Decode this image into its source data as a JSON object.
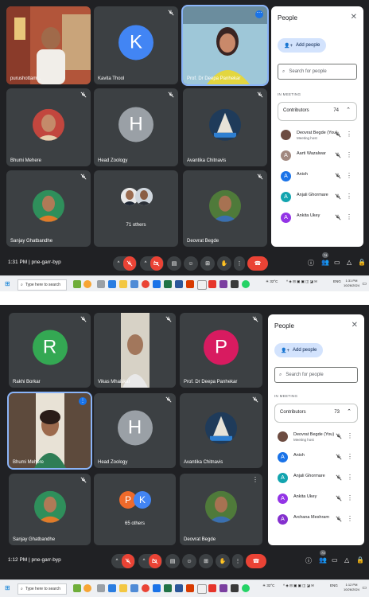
{
  "shots": [
    {
      "meeting": {
        "time": "1:31 PM",
        "separator": "|",
        "code": "pne-garr-byp"
      },
      "tiles": [
        {
          "name": "purushottam..."
        },
        {
          "name": "Kavita Thool",
          "initial": "K",
          "color": "#4285f4"
        },
        {
          "name": "Prof. Dr Deepa Panhekar"
        },
        {
          "name": "Bhumi Mehere"
        },
        {
          "name": "Head Zoology",
          "initial": "H",
          "color": "#9aa0a6"
        },
        {
          "name": "Avantika Chitnavis"
        },
        {
          "name": "Sanjay Ghatbandhe"
        },
        {
          "name": "71 others"
        },
        {
          "name": "Deovrat Begde"
        }
      ],
      "people": {
        "title": "People",
        "add_label": "Add people",
        "search_placeholder": "Search for people",
        "section": "IN MEETING",
        "contributors_label": "Contributors",
        "contributors_count": "74",
        "rows": [
          {
            "name": "Deovrat Begde (You)",
            "sub": "Meeting host",
            "initial": "",
            "color": "#6d4c41"
          },
          {
            "name": "Aarti Wazalwar",
            "sub": "",
            "initial": "A",
            "color": "#a1887f"
          },
          {
            "name": "Anish",
            "sub": "",
            "initial": "A",
            "color": "#1a73e8"
          },
          {
            "name": "Anjali Ghormare",
            "sub": "",
            "initial": "A",
            "color": "#12a4af"
          },
          {
            "name": "Ankita Ukey",
            "sub": "",
            "initial": "A",
            "color": "#9334e6"
          }
        ]
      },
      "participants_badge": "74",
      "taskbar": {
        "search": "Type here to search",
        "temp": "32°C",
        "lang": "ENG",
        "time": "1:31 PM",
        "date": "10/26/2024"
      }
    },
    {
      "meeting": {
        "time": "1:12 PM",
        "separator": "|",
        "code": "pne-garr-byp"
      },
      "tiles": [
        {
          "name": "Rakhi Borkar",
          "initial": "R",
          "color": "#34a853"
        },
        {
          "name": "Vikas Mhaiskar"
        },
        {
          "name": "Prof. Dr Deepa Panhekar",
          "initial": "P",
          "color": "#d81b60"
        },
        {
          "name": "Bhumi Mehere"
        },
        {
          "name": "Head Zoology",
          "initial": "H",
          "color": "#9aa0a6"
        },
        {
          "name": "Avantika Chitnavis"
        },
        {
          "name": "Sanjay Ghatbandhe"
        },
        {
          "name": "65 others"
        },
        {
          "name": "Deovrat Begde"
        }
      ],
      "people": {
        "title": "People",
        "add_label": "Add people",
        "search_placeholder": "Search for people",
        "section": "IN MEETING",
        "contributors_label": "Contributors",
        "contributors_count": "73",
        "rows": [
          {
            "name": "Deovrat Begde (You)",
            "sub": "Meeting host",
            "initial": "",
            "color": "#6d4c41"
          },
          {
            "name": "Anish",
            "sub": "",
            "initial": "A",
            "color": "#1a73e8"
          },
          {
            "name": "Anjali Ghormare",
            "sub": "",
            "initial": "A",
            "color": "#12a4af"
          },
          {
            "name": "Ankita Ukey",
            "sub": "",
            "initial": "A",
            "color": "#9334e6"
          },
          {
            "name": "Archana Meshram",
            "sub": "",
            "initial": "A",
            "color": "#8430ce"
          }
        ]
      },
      "participants_badge": "73",
      "taskbar": {
        "search": "Type here to search",
        "temp": "32°C",
        "lang": "ENG",
        "time": "1:12 PM",
        "date": "10/26/2024"
      }
    }
  ],
  "others_initials": [
    "P",
    "K"
  ],
  "colors": {
    "meet_bg": "#202124",
    "tile_bg": "#3c4043",
    "hangup": "#ea4335",
    "active_border": "#8ab4f8"
  },
  "icons": [
    "mic-off-icon",
    "camera-off-icon",
    "captions-icon",
    "emoji-icon",
    "present-icon",
    "raise-hand-icon",
    "more-icon",
    "hangup-icon",
    "info-icon",
    "people-icon",
    "chat-icon",
    "activities-icon",
    "host-controls-icon",
    "windows-start-icon",
    "search-icon"
  ]
}
